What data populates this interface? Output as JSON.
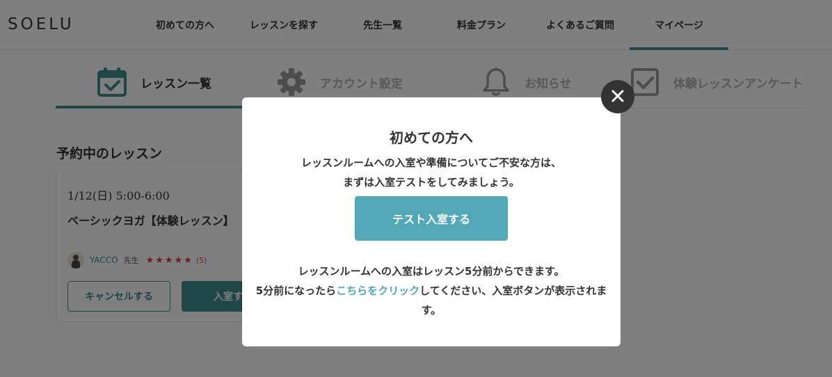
{
  "header": {
    "logo": "SOELU",
    "nav": [
      {
        "label": "初めての方へ"
      },
      {
        "label": "レッスンを探す"
      },
      {
        "label": "先生一覧"
      },
      {
        "label": "料金プラン"
      },
      {
        "label": "よくあるご質問"
      },
      {
        "label": "マイページ"
      }
    ],
    "active_nav": "マイページ"
  },
  "tabs": [
    {
      "label": "レッスン一覧",
      "icon": "calendar-check-icon",
      "active": true
    },
    {
      "label": "アカウント設定",
      "icon": "gear-icon",
      "active": false
    },
    {
      "label": "お知らせ",
      "icon": "bell-icon",
      "active": false
    },
    {
      "label": "体験レッスンアンケート",
      "icon": "checkbox-icon",
      "active": false
    }
  ],
  "lessons": {
    "section_title": "予約中のレッスン",
    "card": {
      "date": "1/12(日) 5:00-6:00",
      "name": "ベーシックヨガ【体験レッスン】",
      "teacher": "YACCO",
      "teacher_suffix": "先生",
      "stars": "★★★★★",
      "rating": 5,
      "review_count": "(5)",
      "cancel_label": "キャンセルする",
      "enter_label": "入室する"
    }
  },
  "modal": {
    "title": "初めての方へ",
    "text1": "レッスンルームへの入室や準備についてご不安な方は、\nまずは入室テストをしてみましょう。",
    "button": "テスト入室する",
    "text2_line1": "レッスンルームへの入室はレッスン5分前からできます。",
    "text2_pre": "5分前になったら",
    "text2_link": "こちらをクリック",
    "text2_post": "してください、入室ボタンが表示されます。"
  },
  "colors": {
    "accent": "#3e8a8f",
    "button_test": "#52a8b6",
    "stars": "#d93b3b",
    "overlay": "rgba(0,0,0,0.5)"
  }
}
